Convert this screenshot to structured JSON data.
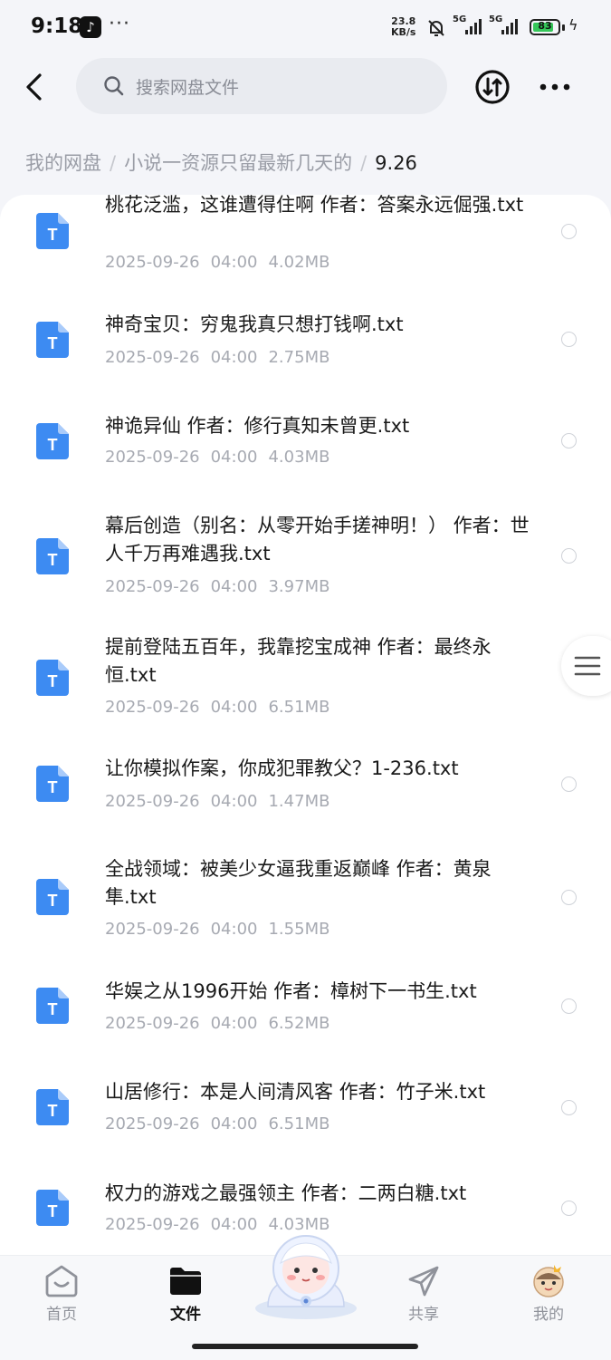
{
  "status_bar": {
    "time": "9:18",
    "more": "···",
    "net_speed_value": "23.8",
    "net_speed_unit": "KB/s",
    "signal1_label": "5G",
    "signal2_label": "5G",
    "battery": "83",
    "battery_level": 0.83,
    "icons": [
      "tiktok-icon",
      "mute-bell-icon",
      "signal-icon",
      "battery-icon",
      "charging-icon"
    ]
  },
  "header": {
    "search_placeholder": "搜索网盘文件"
  },
  "breadcrumb": {
    "items": [
      "我的网盘",
      "小说一资源只留最新几天的",
      "9.26"
    ]
  },
  "files": [
    {
      "name": "桃花泛滥，这谁遭得住啊 作者：答案永远倔强.txt",
      "date": "2025-09-26",
      "time": "04:00",
      "size": "4.02MB"
    },
    {
      "name": "神奇宝贝：穷鬼我真只想打钱啊.txt",
      "date": "2025-09-26",
      "time": "04:00",
      "size": "2.75MB"
    },
    {
      "name": "神诡异仙 作者：修行真知未曾更.txt",
      "date": "2025-09-26",
      "time": "04:00",
      "size": "4.03MB"
    },
    {
      "name": "幕后创造（别名：从零开始手搓神明！） 作者：世人千万再难遇我.txt",
      "date": "2025-09-26",
      "time": "04:00",
      "size": "3.97MB"
    },
    {
      "name": "提前登陆五百年，我靠挖宝成神 作者：最终永恒.txt",
      "date": "2025-09-26",
      "time": "04:00",
      "size": "6.51MB"
    },
    {
      "name": "让你模拟作案，你成犯罪教父？1-236.txt",
      "date": "2025-09-26",
      "time": "04:00",
      "size": "1.47MB"
    },
    {
      "name": "全战领域：被美少女逼我重返巅峰 作者：黄泉隼.txt",
      "date": "2025-09-26",
      "time": "04:00",
      "size": "1.55MB"
    },
    {
      "name": "华娱之从1996开始 作者：樟树下一书生.txt",
      "date": "2025-09-26",
      "time": "04:00",
      "size": "6.52MB"
    },
    {
      "name": "山居修行：本是人间清风客 作者：竹子米.txt",
      "date": "2025-09-26",
      "time": "04:00",
      "size": "6.51MB"
    },
    {
      "name": "权力的游戏之最强领主 作者：二两白糖.txt",
      "date": "2025-09-26",
      "time": "04:00",
      "size": "4.03MB"
    }
  ],
  "file_icon_letter": "T",
  "bottom_nav": {
    "items": [
      {
        "label": "首页",
        "icon": "home-icon"
      },
      {
        "label": "文件",
        "icon": "folder-icon",
        "active": true
      },
      {
        "label": "共享",
        "icon": "share-icon"
      },
      {
        "label": "我的",
        "icon": "profile-avatar-icon"
      }
    ]
  },
  "colors": {
    "accent": "#3d8bf2",
    "background": "#f4f5f9",
    "muted_text": "#a7aab2",
    "battery_green": "#35c759"
  }
}
